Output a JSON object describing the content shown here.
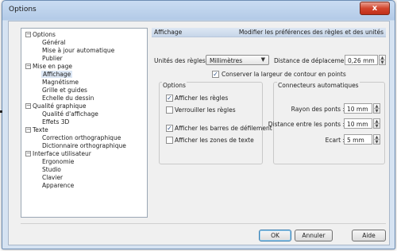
{
  "window": {
    "title": "Options",
    "close_label": "x"
  },
  "tree": {
    "items": [
      {
        "label": "Options",
        "toggle": "−"
      },
      {
        "label": "Général"
      },
      {
        "label": "Mise à jour automatique"
      },
      {
        "label": "Publier"
      },
      {
        "label": "Mise en page",
        "toggle": "−"
      },
      {
        "label": "Affichage"
      },
      {
        "label": "Magnétisme"
      },
      {
        "label": "Grille et guides"
      },
      {
        "label": "Echelle du dessin"
      },
      {
        "label": "Qualité graphique",
        "toggle": "−"
      },
      {
        "label": "Qualité d'affichage"
      },
      {
        "label": "Effets 3D"
      },
      {
        "label": "Texte",
        "toggle": "−"
      },
      {
        "label": "Correction orthographique"
      },
      {
        "label": "Dictionnaire orthographique"
      },
      {
        "label": "Interface utilisateur",
        "toggle": "−"
      },
      {
        "label": "Ergonomie"
      },
      {
        "label": "Studio"
      },
      {
        "label": "Clavier"
      },
      {
        "label": "Apparence"
      }
    ]
  },
  "panel": {
    "title": "Affichage",
    "description": "Modifier les préférences des règles et des unités",
    "units_label": "Unités des règles :",
    "units_value": "Millimètres",
    "move_distance_label": "Distance de déplacement :",
    "move_distance_value": "0,26 mm",
    "keep_border_label": "Conserver la largeur de contour en points",
    "keep_border_checked": true
  },
  "options_group": {
    "title": "Options",
    "items": [
      {
        "label": "Afficher les règles",
        "checked": true
      },
      {
        "label": "Verrouiller les règles",
        "checked": false
      },
      {
        "label": "Afficher les barres de défilement",
        "checked": true
      },
      {
        "label": "Afficher les zones de texte",
        "checked": false
      }
    ]
  },
  "connectors_group": {
    "title": "Connecteurs automatiques",
    "radius_label": "Rayon des ponts :",
    "radius_value": "10 mm",
    "distance_label": "Distance entre les ponts :",
    "distance_value": "10 mm",
    "gap_label": "Ecart :",
    "gap_value": "5 mm"
  },
  "buttons": {
    "ok": "OK",
    "cancel": "Annuler",
    "help": "Aide"
  },
  "check_glyph": "✓"
}
